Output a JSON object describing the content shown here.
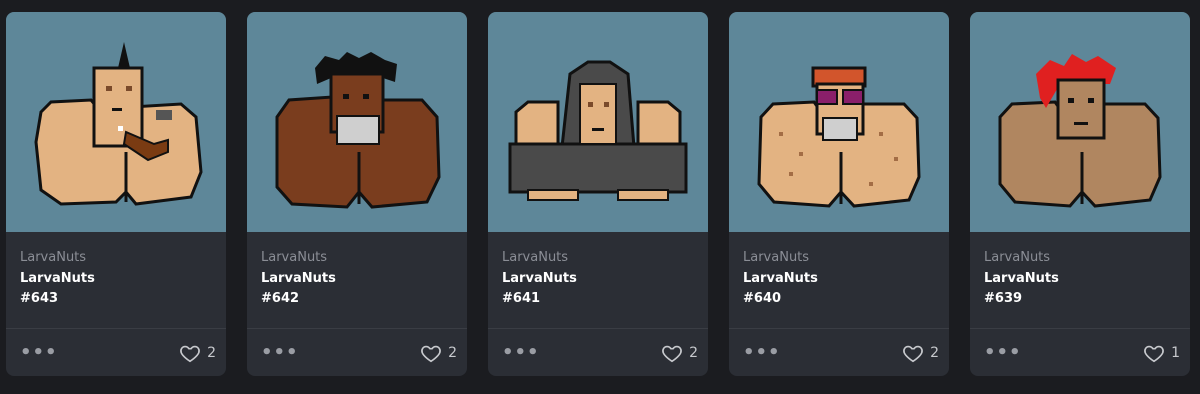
{
  "colors": {
    "page_bg": "#1b1c20",
    "card_bg": "#2b2e35",
    "art_bg": "#5e8799",
    "muted_text": "#8b8e96",
    "title_text": "#ffffff"
  },
  "cards": [
    {
      "collection": "LarvaNuts",
      "name": "LarvaNuts",
      "token": "#643",
      "likes": "2",
      "more_label": "•••",
      "like_icon": "heart-outline-icon"
    },
    {
      "collection": "LarvaNuts",
      "name": "LarvaNuts",
      "token": "#642",
      "likes": "2",
      "more_label": "•••",
      "like_icon": "heart-outline-icon"
    },
    {
      "collection": "LarvaNuts",
      "name": "LarvaNuts",
      "token": "#641",
      "likes": "2",
      "more_label": "•••",
      "like_icon": "heart-outline-icon"
    },
    {
      "collection": "LarvaNuts",
      "name": "LarvaNuts",
      "token": "#640",
      "likes": "2",
      "more_label": "•••",
      "like_icon": "heart-outline-icon"
    },
    {
      "collection": "LarvaNuts",
      "name": "LarvaNuts",
      "token": "#639",
      "likes": "1",
      "more_label": "•••",
      "like_icon": "heart-outline-icon"
    }
  ]
}
